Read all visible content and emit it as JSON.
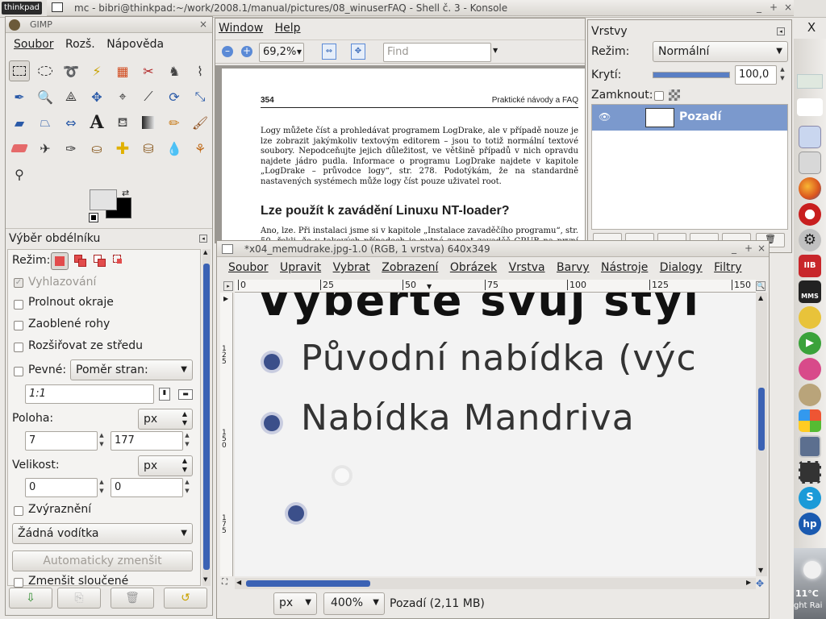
{
  "panel": {
    "hostname": "thinkpad",
    "close_label": "X",
    "weather": "11°C",
    "weather_sub": "ght Rai"
  },
  "konsole": {
    "title": "mc - bibri@thinkpad:~/work/2008.1/manual/pictures/08_winuserFAQ - Shell č. 3 - Konsole"
  },
  "toolbox": {
    "title": "GIMP",
    "menu": [
      "Soubor",
      "Rozš.",
      "Nápověda"
    ],
    "options_title": "Výběr obdélníku",
    "mode_label": "Režim:",
    "antialias_label": "Vyhlazování",
    "feather_label": "Prolnout okraje",
    "rounded_label": "Zaoblené rohy",
    "expand_label": "Rozšiřovat ze středu",
    "fixed_label": "Pevné:",
    "fixed_value": "Poměr stran:",
    "ratio_value": "1:1",
    "position_label": "Poloha:",
    "position_unit": "px",
    "pos_x": "7",
    "pos_y": "177",
    "size_label": "Velikost:",
    "size_unit": "px",
    "size_w": "0",
    "size_h": "0",
    "highlight_label": "Zvýraznění",
    "guides_value": "Žádná vodítka",
    "autoshrink_label": "Automaticky zmenšit",
    "shrink_merged_label": "Zmenšit sloučené"
  },
  "viewer": {
    "menu": [
      "Window",
      "Help"
    ],
    "zoom": "69,2%",
    "find_placeholder": "Find",
    "page_number": "354",
    "header_right": "Praktické návody a FAQ",
    "para1": "Logy můžete číst a prohledávat programem LogDrake, ale v případě nouze je lze zobrazit jakýmkoliv textovým editorem – jsou to totiž normální textové soubory. Nepodceňujte jejich důležitost, ve většině případů v nich opravdu najdete jádro pudla. Informace o programu LogDrake najdete v kapitole „LogDrake – průvodce logy“, str. 278. Podotýkám, že na standardně nastavených systémech může logy číst pouze uživatel root.",
    "heading": "Lze použít k zavádění Linuxu NT-loader?",
    "para2": "Ano, lze. Při instalaci jsme si v kapitole „Instalace zavaděčího programu“, str. 50, řekli, že v takových případech je nutné zapsat zavaděč GRUB na první sektor linuxového"
  },
  "layers": {
    "title": "Vrstvy",
    "mode_label": "Režim:",
    "mode_value": "Normální",
    "opacity_label": "Krytí:",
    "opacity_value": "100,0",
    "opacity_fraction": 1.0,
    "lock_label": "Zamknout:",
    "layer_name": "Pozadí"
  },
  "image": {
    "title": "*x04_memudrake.jpg-1.0 (RGB, 1 vrstva) 640x349",
    "menu": [
      "Soubor",
      "Upravit",
      "Vybrat",
      "Zobrazení",
      "Obrázek",
      "Vrstva",
      "Barvy",
      "Nástroje",
      "Dialogy",
      "Filtry"
    ],
    "ruler_ticks": [
      "0",
      "25",
      "50",
      "75",
      "100",
      "125",
      "150"
    ],
    "vruler_ticks": [
      "125",
      "150",
      "175"
    ],
    "canvas_lines": [
      "Vyberte svůj styl",
      "Původní nabídka (výc",
      "Nabídka Mandriva"
    ],
    "unit": "px",
    "zoom": "400%",
    "status": "Pozadí (2,11 MB)"
  }
}
